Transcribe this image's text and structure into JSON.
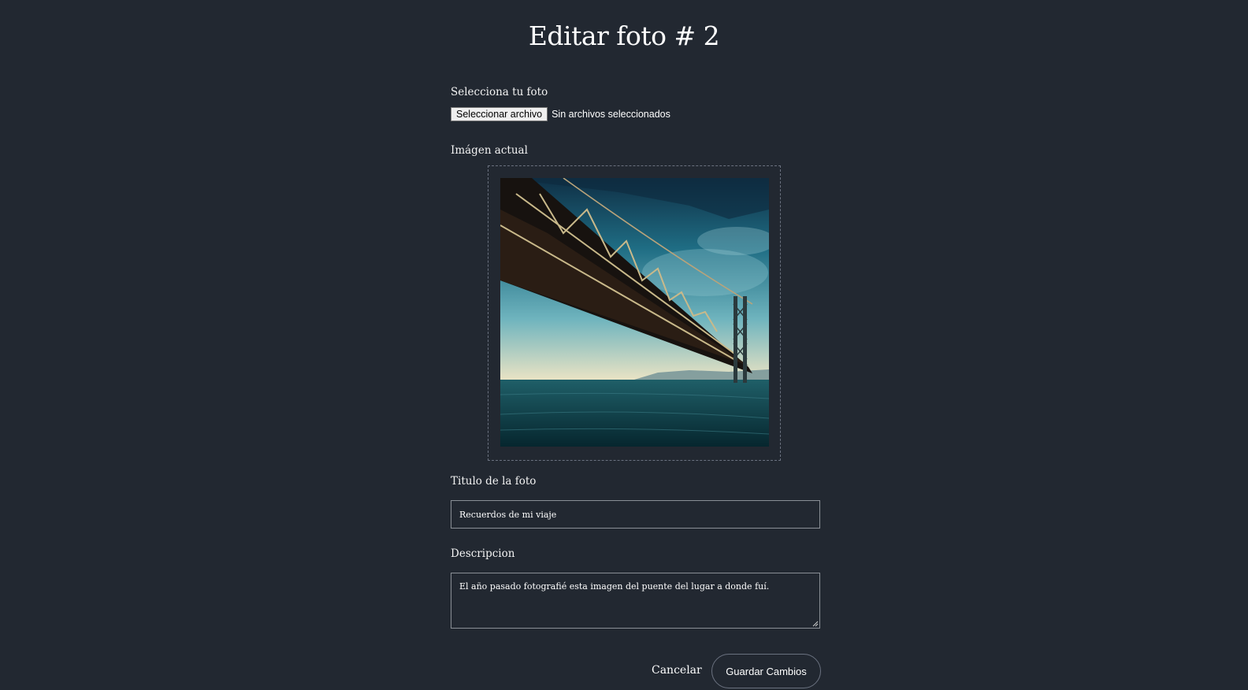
{
  "page": {
    "title": "Editar foto # 2"
  },
  "upload": {
    "label": "Selecciona tu foto",
    "button_label": "Seleccionar archivo",
    "status": "Sin archivos seleccionados"
  },
  "current_image": {
    "label": "Imágen actual"
  },
  "title_field": {
    "label": "Titulo de la foto",
    "value": "Recuerdos de mi viaje"
  },
  "description_field": {
    "label": "Descripcion",
    "value": "El año pasado fotografié esta imagen del puente del lugar a donde fuí."
  },
  "actions": {
    "cancel_label": "Cancelar",
    "save_label": "Guardar Cambios"
  },
  "colors": {
    "background": "#222831",
    "border": "#8a8f96",
    "text": "#ffffff"
  }
}
